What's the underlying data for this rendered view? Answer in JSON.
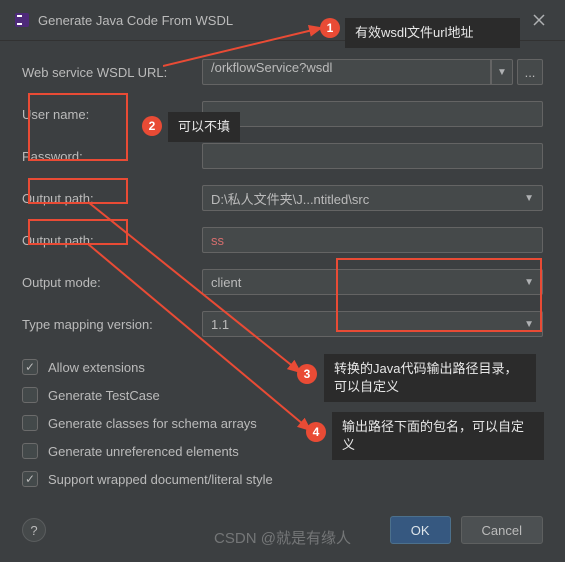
{
  "title": "Generate Java Code From WSDL",
  "fields": {
    "wsdl_url": {
      "label": "Web service WSDL URL:",
      "value": "/orkflowService?wsdl"
    },
    "username": {
      "label": "User name:",
      "value": ""
    },
    "password": {
      "label": "Password:",
      "value": ""
    },
    "output_path1": {
      "label": "Output path:",
      "value": "D:\\私人文件夹\\J...ntitled\\src"
    },
    "output_path2": {
      "label": "Output path:",
      "value": "ss"
    },
    "output_mode": {
      "label": "Output mode:",
      "value": "client"
    },
    "type_mapping": {
      "label": "Type mapping version:",
      "value": "1.1"
    }
  },
  "checks": [
    {
      "label": "Allow extensions",
      "checked": true
    },
    {
      "label": "Generate TestCase",
      "checked": false
    },
    {
      "label": "Generate classes for schema arrays",
      "checked": false
    },
    {
      "label": "Generate unreferenced elements",
      "checked": false
    },
    {
      "label": "Support wrapped document/literal style",
      "checked": true
    }
  ],
  "buttons": {
    "ok": "OK",
    "cancel": "Cancel",
    "help": "?",
    "browse": "..."
  },
  "annotations": {
    "n1": "1",
    "t1": "有效wsdl文件url地址",
    "n2": "2",
    "t2": "可以不填",
    "n3": "3",
    "t3": "转换的Java代码输出路径目录，可以自定义",
    "n4": "4",
    "t4": "输出路径下面的包名，可以自定义"
  },
  "watermark": "CSDN @就是有缘人"
}
